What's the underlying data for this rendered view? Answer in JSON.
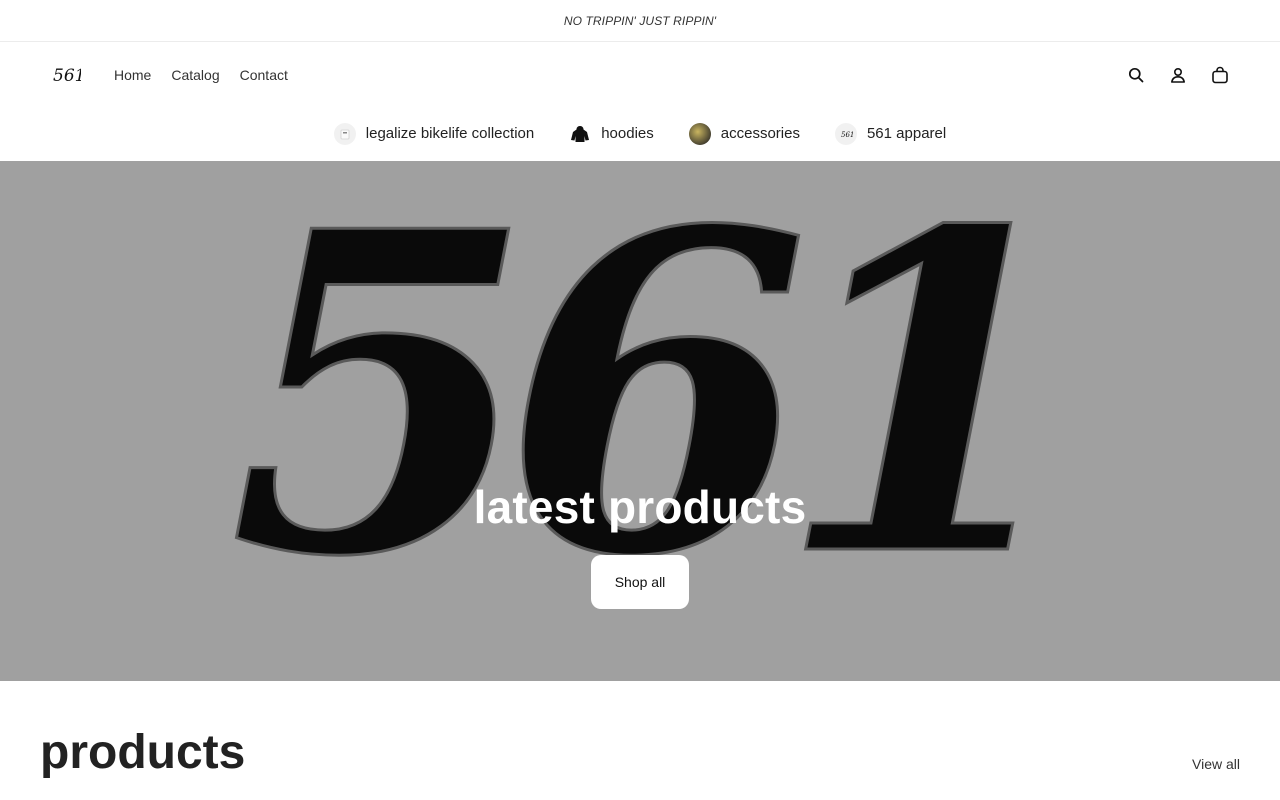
{
  "announcement": {
    "text": "NO TRIPPIN' JUST RIPPIN'"
  },
  "header": {
    "logo_text": "561",
    "nav": [
      {
        "label": "Home"
      },
      {
        "label": "Catalog"
      },
      {
        "label": "Contact"
      }
    ],
    "icons": [
      "search-icon",
      "account-icon",
      "cart-icon"
    ]
  },
  "collections": [
    {
      "label": "legalize bikelife collection",
      "thumb": "tee-thumbnail"
    },
    {
      "label": "hoodies",
      "thumb": "hoodie-thumbnail"
    },
    {
      "label": "accessories",
      "thumb": "accessory-thumbnail"
    },
    {
      "label": "561 apparel",
      "thumb": "logo-thumbnail"
    }
  ],
  "hero": {
    "art_text": "561",
    "title": "latest products",
    "button_label": "Shop all",
    "background_color": "#a0a0a0"
  },
  "products_section": {
    "title": "products",
    "view_all_label": "View all"
  }
}
